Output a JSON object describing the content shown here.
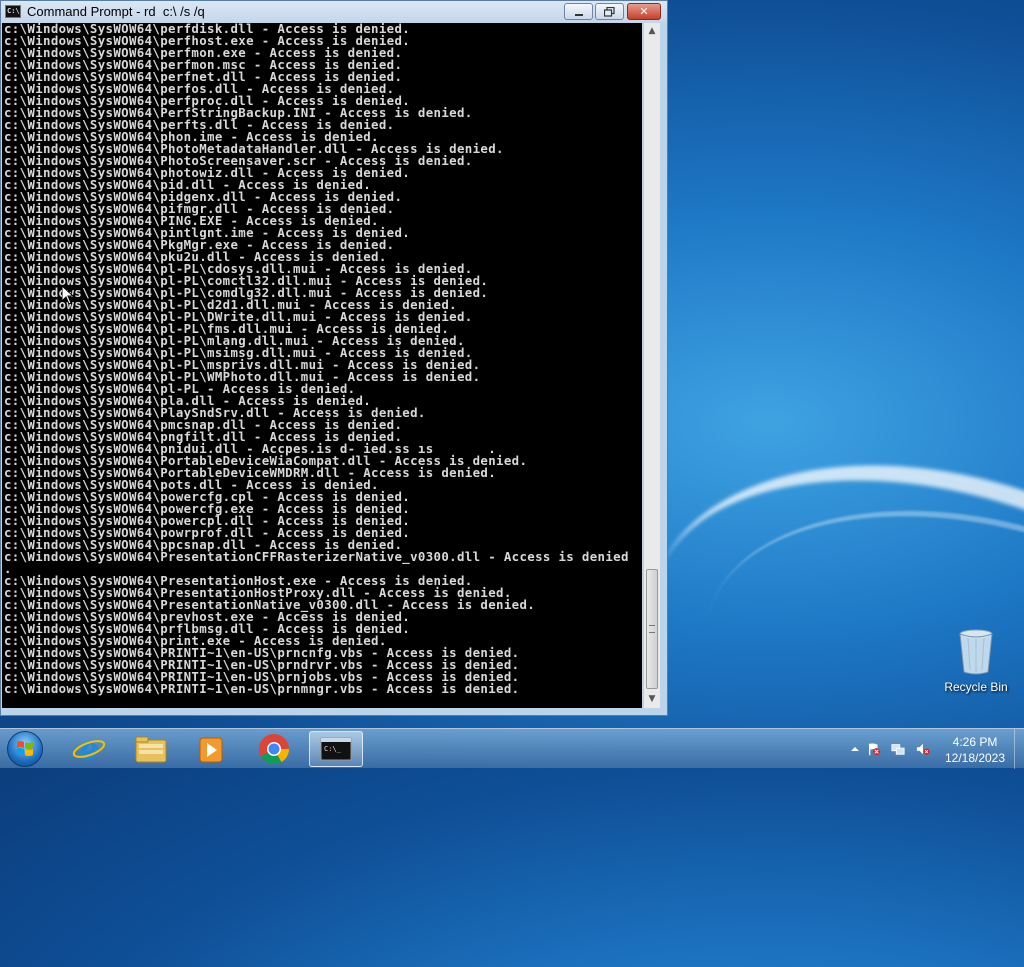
{
  "window": {
    "title": "Command Prompt - rd  c:\\ /s /q",
    "icon_text": "C:\\",
    "min_label": "",
    "max_label": "",
    "close_label": "✕"
  },
  "console_lines": [
    "c:\\Windows\\SysWOW64\\perfdisk.dll - Access is denied.",
    "c:\\Windows\\SysWOW64\\perfhost.exe - Access is denied.",
    "c:\\Windows\\SysWOW64\\perfmon.exe - Access is denied.",
    "c:\\Windows\\SysWOW64\\perfmon.msc - Access is denied.",
    "c:\\Windows\\SysWOW64\\perfnet.dll - Access is denied.",
    "c:\\Windows\\SysWOW64\\perfos.dll - Access is denied.",
    "c:\\Windows\\SysWOW64\\perfproc.dll - Access is denied.",
    "c:\\Windows\\SysWOW64\\PerfStringBackup.INI - Access is denied.",
    "c:\\Windows\\SysWOW64\\perfts.dll - Access is denied.",
    "c:\\Windows\\SysWOW64\\phon.ime - Access is denied.",
    "c:\\Windows\\SysWOW64\\PhotoMetadataHandler.dll - Access is denied.",
    "c:\\Windows\\SysWOW64\\PhotoScreensaver.scr - Access is denied.",
    "c:\\Windows\\SysWOW64\\photowiz.dll - Access is denied.",
    "c:\\Windows\\SysWOW64\\pid.dll - Access is denied.",
    "c:\\Windows\\SysWOW64\\pidgenx.dll - Access is denied.",
    "c:\\Windows\\SysWOW64\\pifmgr.dll - Access is denied.",
    "c:\\Windows\\SysWOW64\\PING.EXE - Access is denied.",
    "c:\\Windows\\SysWOW64\\pintlgnt.ime - Access is denied.",
    "c:\\Windows\\SysWOW64\\PkgMgr.exe - Access is denied.",
    "c:\\Windows\\SysWOW64\\pku2u.dll - Access is denied.",
    "c:\\Windows\\SysWOW64\\pl-PL\\cdosys.dll.mui - Access is denied.",
    "c:\\Windows\\SysWOW64\\pl-PL\\comctl32.dll.mui - Access is denied.",
    "c:\\Windows\\SysWOW64\\pl-PL\\comdlg32.dll.mui - Access is denied.",
    "c:\\Windows\\SysWOW64\\pl-PL\\d2d1.dll.mui - Access is denied.",
    "c:\\Windows\\SysWOW64\\pl-PL\\DWrite.dll.mui - Access is denied.",
    "c:\\Windows\\SysWOW64\\pl-PL\\fms.dll.mui - Access is denied.",
    "c:\\Windows\\SysWOW64\\pl-PL\\mlang.dll.mui - Access is denied.",
    "c:\\Windows\\SysWOW64\\pl-PL\\msimsg.dll.mui - Access is denied.",
    "c:\\Windows\\SysWOW64\\pl-PL\\msprivs.dll.mui - Access is denied.",
    "c:\\Windows\\SysWOW64\\pl-PL\\WMPhoto.dll.mui - Access is denied.",
    "c:\\Windows\\SysWOW64\\pl-PL - Access is denied.",
    "c:\\Windows\\SysWOW64\\pla.dll - Access is denied.",
    "c:\\Windows\\SysWOW64\\PlaySndSrv.dll - Access is denied.",
    "c:\\Windows\\SysWOW64\\pmcsnap.dll - Access is denied.",
    "c:\\Windows\\SysWOW64\\pngfilt.dll - Access is denied.",
    "c:\\Windows\\SysWOW64\\pnidui.dll - Accpes.is d- ied.ss ıs       .",
    "c:\\Windows\\SysWOW64\\PortableDeviceWiaCompat.dll - Access is denied.",
    "c:\\Windows\\SysWOW64\\PortableDeviceWMDRM.dll - Access is denied.",
    "c:\\Windows\\SysWOW64\\pots.dll - Access is denied.",
    "c:\\Windows\\SysWOW64\\powercfg.cpl - Access is denied.",
    "c:\\Windows\\SysWOW64\\powercfg.exe - Access is denied.",
    "c:\\Windows\\SysWOW64\\powercpl.dll - Access is denied.",
    "c:\\Windows\\SysWOW64\\powrprof.dll - Access is denied.",
    "c:\\Windows\\SysWOW64\\ppcsnap.dll - Access is denied.",
    "c:\\Windows\\SysWOW64\\PresentationCFFRasterizerNative_v0300.dll - Access is denied",
    ".",
    "c:\\Windows\\SysWOW64\\PresentationHost.exe - Access is denied.",
    "c:\\Windows\\SysWOW64\\PresentationHostProxy.dll - Access is denied.",
    "c:\\Windows\\SysWOW64\\PresentationNative_v0300.dll - Access is denied.",
    "c:\\Windows\\SysWOW64\\prevhost.exe - Access is denied.",
    "c:\\Windows\\SysWOW64\\prflbmsg.dll - Access is denied.",
    "c:\\Windows\\SysWOW64\\print.exe - Access is denied.",
    "c:\\Windows\\SysWOW64\\PRINTI~1\\en-US\\prncnfg.vbs - Access is denied.",
    "c:\\Windows\\SysWOW64\\PRINTI~1\\en-US\\prndrvr.vbs - Access is denied.",
    "c:\\Windows\\SysWOW64\\PRINTI~1\\en-US\\prnjobs.vbs - Access is denied.",
    "c:\\Windows\\SysWOW64\\PRINTI~1\\en-US\\prnmngr.vbs - Access is denied."
  ],
  "desktop": {
    "recycle_bin_label": "Recycle Bin"
  },
  "taskbar": {
    "apps": [
      {
        "name": "internet-explorer",
        "icon": "ie-icon"
      },
      {
        "name": "file-explorer",
        "icon": "folder-icon"
      },
      {
        "name": "media-player",
        "icon": "media-player-icon"
      },
      {
        "name": "chrome",
        "icon": "chrome-icon"
      },
      {
        "name": "command-prompt",
        "icon": "cmd-icon",
        "active": true
      }
    ],
    "clock_time": "4:26 PM",
    "clock_date": "12/18/2023"
  }
}
